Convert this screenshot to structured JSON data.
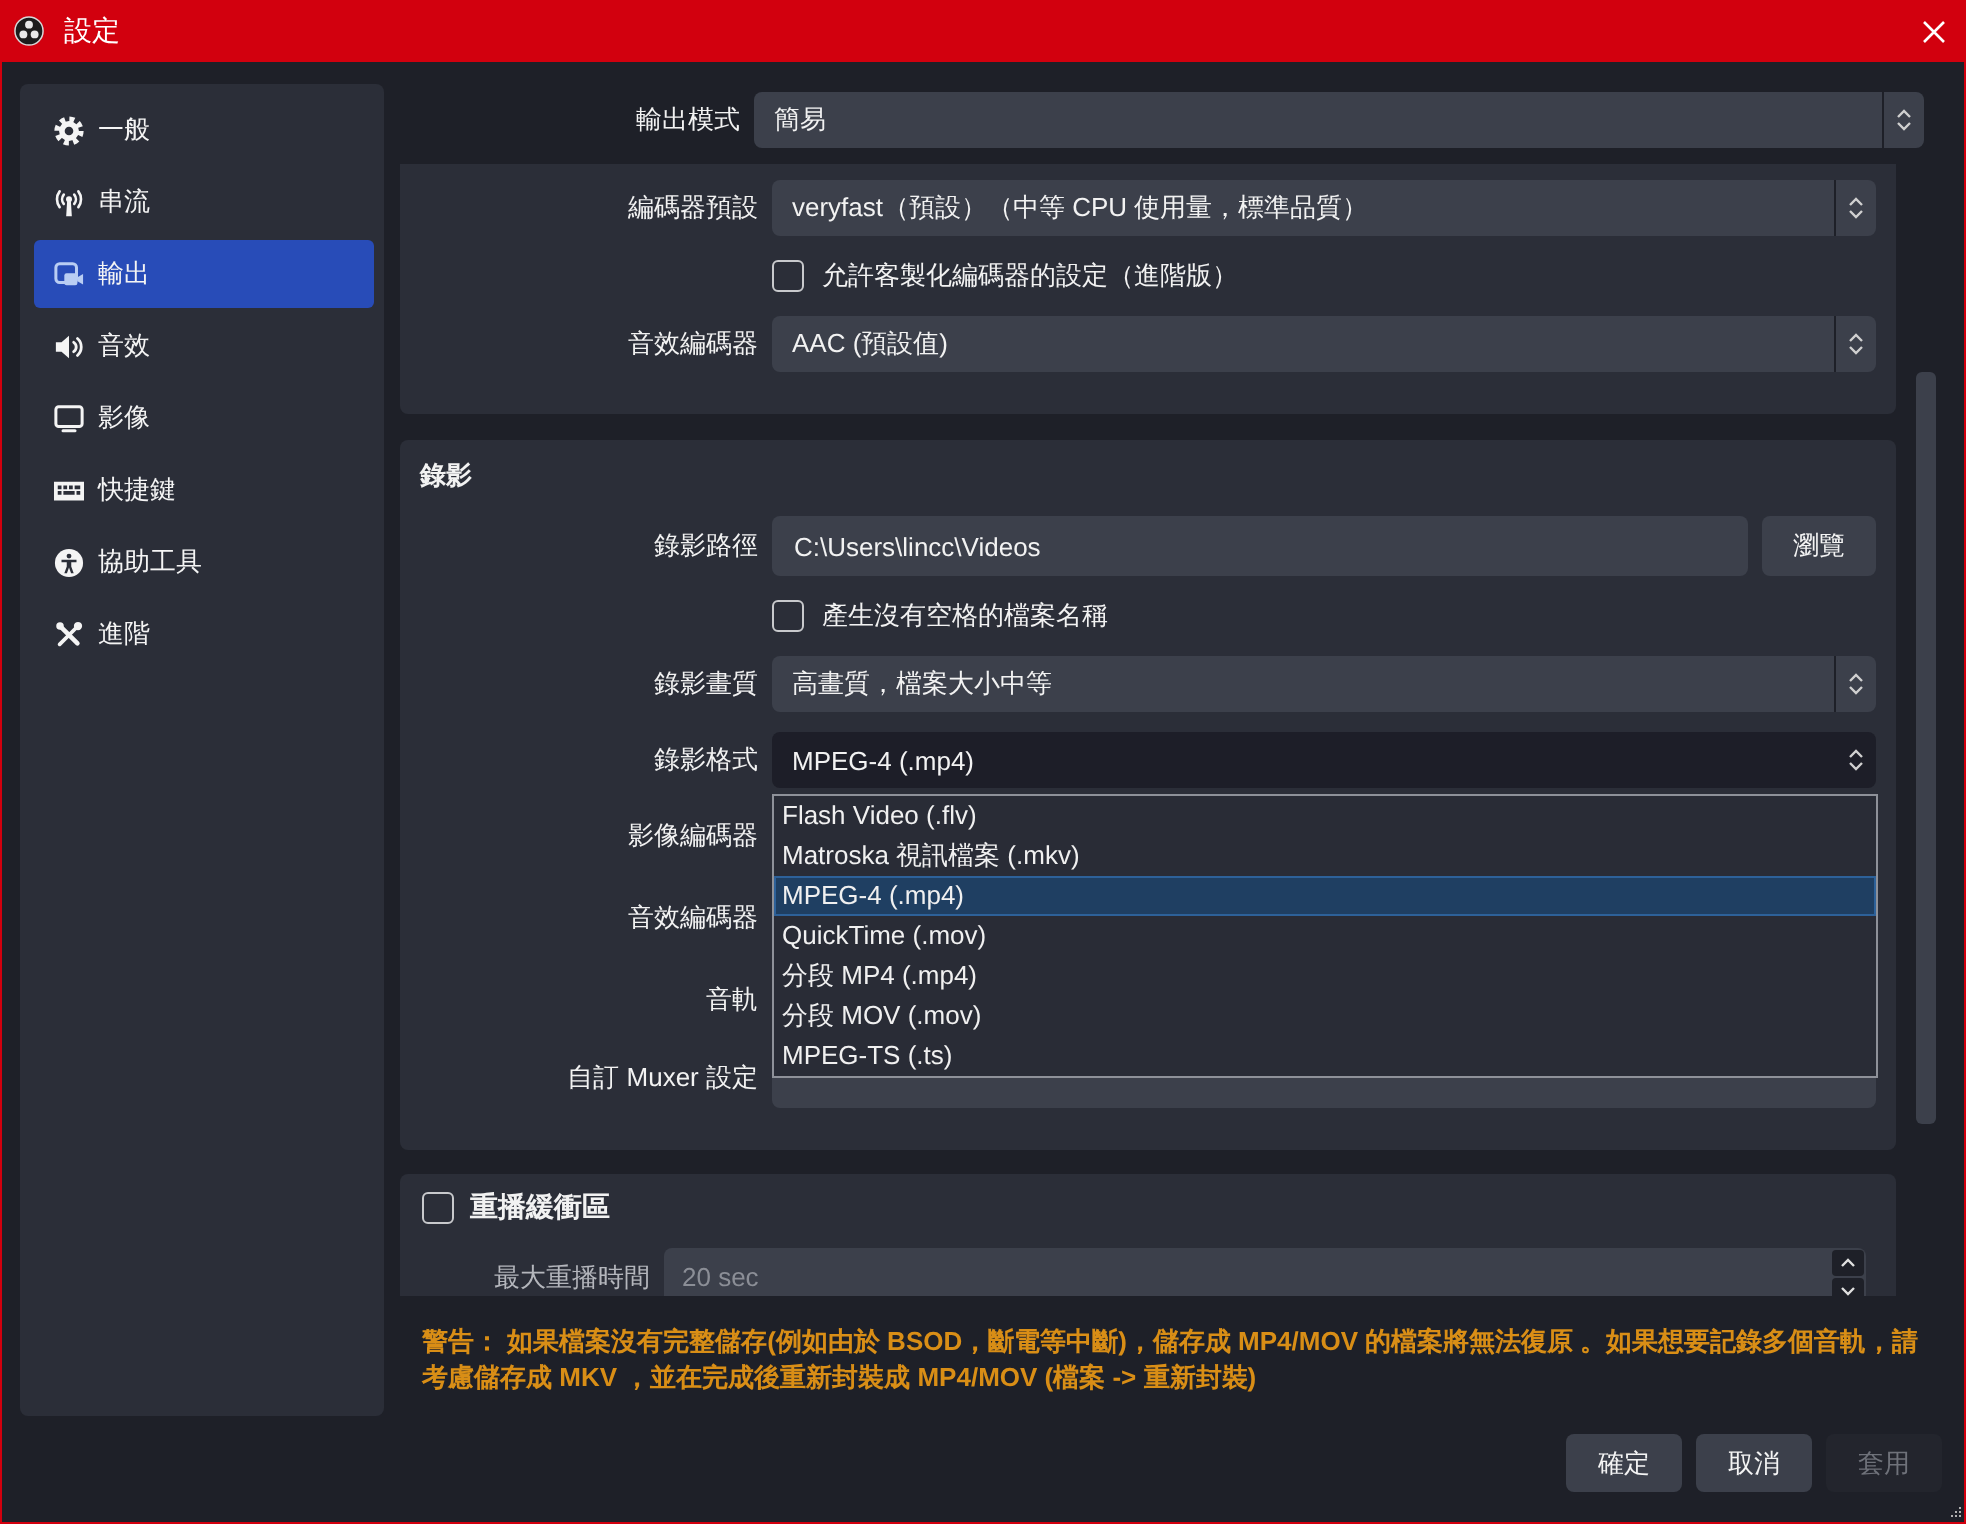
{
  "window": {
    "title": "設定"
  },
  "sidebar": {
    "items": [
      {
        "label": "一般",
        "selected": false
      },
      {
        "label": "串流",
        "selected": false
      },
      {
        "label": "輸出",
        "selected": true
      },
      {
        "label": "音效",
        "selected": false
      },
      {
        "label": "影像",
        "selected": false
      },
      {
        "label": "快捷鍵",
        "selected": false
      },
      {
        "label": "協助工具",
        "selected": false
      },
      {
        "label": "進階",
        "selected": false
      }
    ]
  },
  "output_mode": {
    "label": "輸出模式",
    "value": "簡易"
  },
  "encoder_section": {
    "rows": [
      {
        "kind": "combo",
        "label": "編碼器預設",
        "value": "veryfast（預設）（中等 CPU 使用量，標準品質）"
      },
      {
        "kind": "checkbox",
        "label": "允許客製化編碼器的設定（進階版）",
        "checked": false
      },
      {
        "kind": "combo",
        "label": "音效編碼器",
        "value": "AAC (預設值)"
      }
    ]
  },
  "recording": {
    "title": "錄影",
    "rows": [
      {
        "kind": "path",
        "label": "錄影路徑",
        "value": "C:\\Users\\lincc\\Videos",
        "button": "瀏覽"
      },
      {
        "kind": "checkbox",
        "label": "產生沒有空格的檔案名稱",
        "checked": false
      },
      {
        "kind": "combo",
        "label": "錄影畫質",
        "value": "高畫質，檔案大小中等"
      },
      {
        "kind": "dropdown",
        "label": "錄影格式",
        "value": "MPEG-4 (.mp4)",
        "expanded": true,
        "options": [
          {
            "label": "Flash Video (.flv)",
            "selected": false
          },
          {
            "label": "Matroska 視訊檔案 (.mkv)",
            "selected": false
          },
          {
            "label": "MPEG-4 (.mp4)",
            "selected": true
          },
          {
            "label": "QuickTime (.mov)",
            "selected": false
          },
          {
            "label": "分段 MP4 (.mp4)",
            "selected": false
          },
          {
            "label": "分段 MOV (.mov)",
            "selected": false
          },
          {
            "label": "MPEG-TS (.ts)",
            "selected": false
          }
        ]
      },
      {
        "kind": "label",
        "label": "影像編碼器"
      },
      {
        "kind": "label",
        "label": "音效編碼器"
      },
      {
        "kind": "label",
        "label": "音軌"
      },
      {
        "kind": "field",
        "label": "自訂 Muxer 設定"
      }
    ]
  },
  "replay_buffer": {
    "title": "重播緩衝區",
    "checked": false,
    "max_time": {
      "label": "最大重播時間",
      "value": "20 sec",
      "disabled": true
    }
  },
  "warning": "警告： 如果檔案沒有完整儲存(例如由於 BSOD，斷電等中斷)，儲存成 MP4/MOV 的檔案將無法復原 。如果想要記錄多個音軌，請考慮儲存成 MKV ，並在完成後重新封裝成 MP4/MOV (檔案 -> 重新封裝)",
  "buttons": [
    {
      "label": "確定",
      "disabled": false
    },
    {
      "label": "取消",
      "disabled": false
    },
    {
      "label": "套用",
      "disabled": true
    }
  ]
}
